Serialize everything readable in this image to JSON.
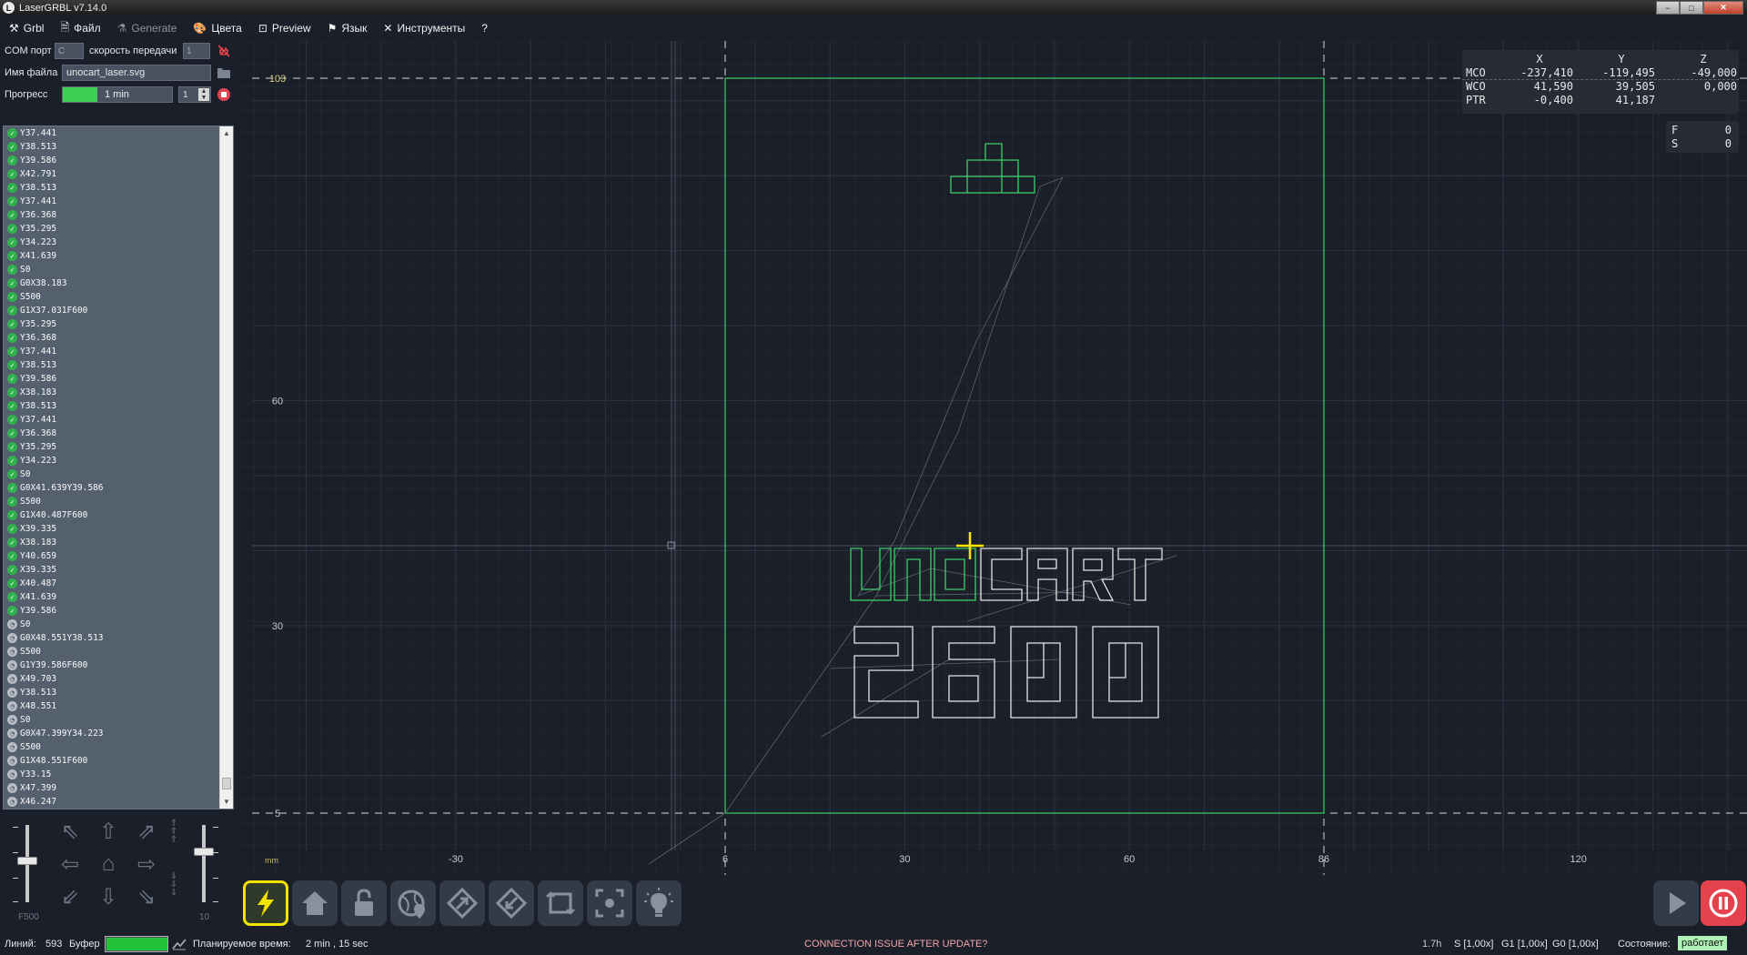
{
  "window": {
    "title": "LaserGRBL v7.14.0",
    "min": "−",
    "max": "□",
    "close": "✕"
  },
  "menu": [
    {
      "label": "Grbl",
      "icon": "tools-icon"
    },
    {
      "label": "Файл",
      "icon": "file-icon"
    },
    {
      "label": "Generate",
      "icon": "generate-icon",
      "disabled": true
    },
    {
      "label": "Цвета",
      "icon": "palette-icon"
    },
    {
      "label": "Preview",
      "icon": "preview-icon"
    },
    {
      "label": "Язык",
      "icon": "flag-icon"
    },
    {
      "label": "Инструменты",
      "icon": "wrench-icon"
    },
    {
      "label": "?",
      "icon": ""
    }
  ],
  "connection": {
    "com_label": "COM порт",
    "com_value": "C",
    "baud_label": "скорость передачи",
    "baud_value": "1",
    "file_label": "Имя файла",
    "file_value": "unocart_laser.svg",
    "progress_label": "Прогресс",
    "progress_fraction": 0.95,
    "progress_time": "1 min",
    "copies_value": "1"
  },
  "code_list": {
    "header": "",
    "lines": [
      {
        "text": "Y37.441",
        "done": true
      },
      {
        "text": "Y38.513",
        "done": true
      },
      {
        "text": "Y39.586",
        "done": true
      },
      {
        "text": "X42.791",
        "done": true
      },
      {
        "text": "Y38.513",
        "done": true
      },
      {
        "text": "Y37.441",
        "done": true
      },
      {
        "text": "Y36.368",
        "done": true
      },
      {
        "text": "Y35.295",
        "done": true
      },
      {
        "text": "Y34.223",
        "done": true
      },
      {
        "text": "X41.639",
        "done": true
      },
      {
        "text": "S0",
        "done": true
      },
      {
        "text": "G0X38.183",
        "done": true
      },
      {
        "text": "S500",
        "done": true
      },
      {
        "text": "G1X37.031F600",
        "done": true
      },
      {
        "text": "Y35.295",
        "done": true
      },
      {
        "text": "Y36.368",
        "done": true
      },
      {
        "text": "Y37.441",
        "done": true
      },
      {
        "text": "Y38.513",
        "done": true
      },
      {
        "text": "Y39.586",
        "done": true
      },
      {
        "text": "X38.183",
        "done": true
      },
      {
        "text": "Y38.513",
        "done": true
      },
      {
        "text": "Y37.441",
        "done": true
      },
      {
        "text": "Y36.368",
        "done": true
      },
      {
        "text": "Y35.295",
        "done": true
      },
      {
        "text": "Y34.223",
        "done": true
      },
      {
        "text": "S0",
        "done": true
      },
      {
        "text": "G0X41.639Y39.586",
        "done": true
      },
      {
        "text": "S500",
        "done": true
      },
      {
        "text": "G1X40.487F600",
        "done": true
      },
      {
        "text": "X39.335",
        "done": true
      },
      {
        "text": "X38.183",
        "done": true
      },
      {
        "text": "Y40.659",
        "done": true
      },
      {
        "text": "X39.335",
        "done": true
      },
      {
        "text": "X40.487",
        "done": true
      },
      {
        "text": "X41.639",
        "done": true
      },
      {
        "text": "Y39.586",
        "done": true
      },
      {
        "text": "S0",
        "done": false
      },
      {
        "text": "G0X48.551Y38.513",
        "done": false
      },
      {
        "text": "S500",
        "done": false
      },
      {
        "text": "G1Y39.586F600",
        "done": false
      },
      {
        "text": "X49.703",
        "done": false
      },
      {
        "text": "Y38.513",
        "done": false
      },
      {
        "text": "X48.551",
        "done": false
      },
      {
        "text": "S0",
        "done": false
      },
      {
        "text": "G0X47.399Y34.223",
        "done": false
      },
      {
        "text": "S500",
        "done": false
      },
      {
        "text": "G1X48.551F600",
        "done": false
      },
      {
        "text": "Y33.15",
        "done": false
      },
      {
        "text": "X47.399",
        "done": false
      },
      {
        "text": "X46.247",
        "done": false
      }
    ]
  },
  "jog": {
    "feed_label": "F500",
    "step_label": "10"
  },
  "preview": {
    "unit_label": "mm",
    "x_ticks": [
      "-30",
      "6",
      "30",
      "60",
      "86",
      "120"
    ],
    "y_ticks": [
      "103",
      "60",
      "30",
      "5"
    ],
    "x_tick_values": [
      -30,
      6,
      30,
      60,
      86,
      120
    ],
    "y_tick_values": [
      103,
      60,
      30,
      5
    ],
    "work_area_color": "#3ecf6a",
    "cursor_color": "#ffe800"
  },
  "dro": {
    "headers": [
      "X",
      "Y",
      "Z"
    ],
    "rows": [
      {
        "label": "MCO",
        "x": "-237,410",
        "y": "-119,495",
        "z": "-49,000"
      },
      {
        "label": "WCO",
        "x": "41,590",
        "y": "39,505",
        "z": "0,000"
      },
      {
        "label": "PTR",
        "x": "-0,400",
        "y": "41,187",
        "z": ""
      }
    ],
    "fs": [
      {
        "label": "F",
        "value": "0"
      },
      {
        "label": "S",
        "value": "0"
      }
    ]
  },
  "toolbar": {
    "buttons": [
      "connect-icon",
      "home-icon",
      "unlock-icon",
      "globe-pin-icon",
      "arrow-out-icon",
      "arrow-back-icon",
      "frame-icon",
      "center-focus-icon",
      "light-bulb-icon"
    ],
    "accent": "#f4e300",
    "right_buttons": [
      "play-icon",
      "pause-icon"
    ],
    "pause_color": "#e4424d"
  },
  "status": {
    "lines_label": "Линий:",
    "lines_value": "593",
    "buffer_label": "Буфер",
    "buffer_fraction": 0.98,
    "planned_label": "Планируемое время:",
    "planned_value": "2 min , 15 sec",
    "alert": "CONNECTION ISSUE AFTER UPDATE?",
    "alert_color": "#f2a6a6",
    "version": "1.7h",
    "s_override": "S [1,00x]",
    "g1_override": "G1 [1,00x]",
    "g0_override": "G0 [1,00x]",
    "state_label": "Состояние:",
    "state_value": "работает"
  }
}
